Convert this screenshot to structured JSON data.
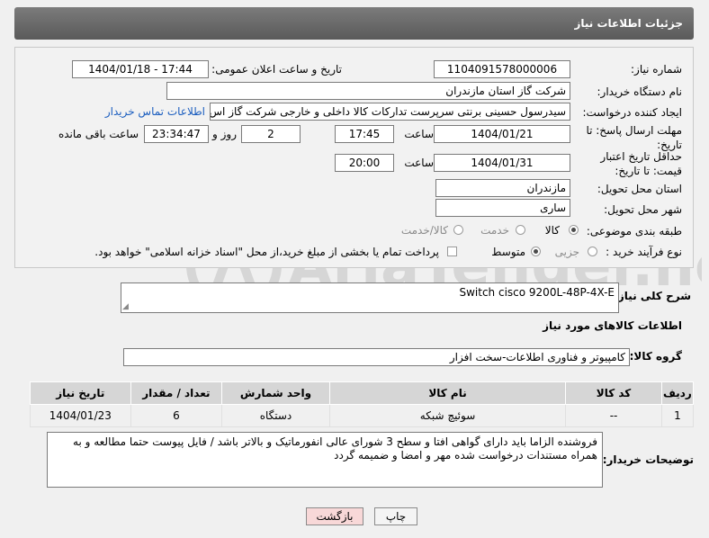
{
  "header": {
    "title": "جزئیات اطلاعات نیاز"
  },
  "fields": {
    "need_number_label": "شماره نیاز:",
    "need_number": "1104091578000006",
    "announce_label": "تاریخ و ساعت اعلان عمومی:",
    "announce_value": "1404/01/18 - 17:44",
    "buyer_org_label": "نام دستگاه خریدار:",
    "buyer_org": "شرکت گاز استان مازندران",
    "creator_label": "ایجاد کننده درخواست:",
    "creator": "سیدرسول حسینی برنتی سرپرست تدارکات کالا داخلی و خارجی  شرکت گاز اس",
    "contact_link": "اطلاعات تماس خریدار",
    "deadline_label": "مهلت ارسال پاسخ: تا تاریخ:",
    "deadline_date": "1404/01/21",
    "time_label": "ساعت",
    "deadline_time": "17:45",
    "days_value": "2",
    "days_label": "روز و",
    "remaining_time": "23:34:47",
    "remaining_label": "ساعت باقی مانده",
    "price_valid_label": "حداقل تاریخ اعتبار قیمت: تا تاریخ:",
    "price_valid_date": "1404/01/31",
    "price_valid_time": "20:00",
    "province_label": "استان محل تحویل:",
    "province": "مازندران",
    "city_label": "شهر محل تحویل:",
    "city": "ساری",
    "category_label": "طبقه بندی موضوعی:",
    "category_options": [
      "کالا",
      "خدمت",
      "کالا/خدمت"
    ],
    "category_selected": "کالا",
    "purchase_type_label": "نوع فرآیند خرید :",
    "purchase_options": [
      "جزیی",
      "متوسط"
    ],
    "purchase_selected": "متوسط",
    "payment_note": "پرداخت تمام یا بخشی از مبلغ خرید،از محل \"اسناد خزانه اسلامی\" خواهد بود."
  },
  "description": {
    "label": "شرح کلی نیاز:",
    "value": "Switch cisco 9200L-48P-4X-E"
  },
  "goods": {
    "section_title": "اطلاعات کالاهای مورد نیاز",
    "group_label": "گروه کالا:",
    "group_value": "کامپیوتر و فناوری اطلاعات-سخت افزار"
  },
  "table": {
    "headers": [
      "ردیف",
      "کد کالا",
      "نام کالا",
      "واحد شمارش",
      "تعداد / مقدار",
      "تاریخ نیاز"
    ],
    "rows": [
      [
        "1",
        "--",
        "سوئیچ شبکه",
        "دستگاه",
        "6",
        "1404/01/23"
      ]
    ]
  },
  "buyer_notes": {
    "label": "توضیحات خریدار:",
    "value": "فروشنده الزاما باید دارای گواهی افتا و سطح 3 شورای عالی انفورماتیک و بالاتر باشد / فایل پیوست حتما مطالعه و به همراه مستندات درخواست شده مهر و امضا و ضمیمه گردد"
  },
  "buttons": {
    "print": "چاپ",
    "back": "بازگشت"
  },
  "watermark": {
    "text": "AriaTender.neT"
  },
  "colors": {
    "header_bg": "#666666",
    "link": "#1a5dbf",
    "back_button_bg": "#f8d8d8"
  }
}
